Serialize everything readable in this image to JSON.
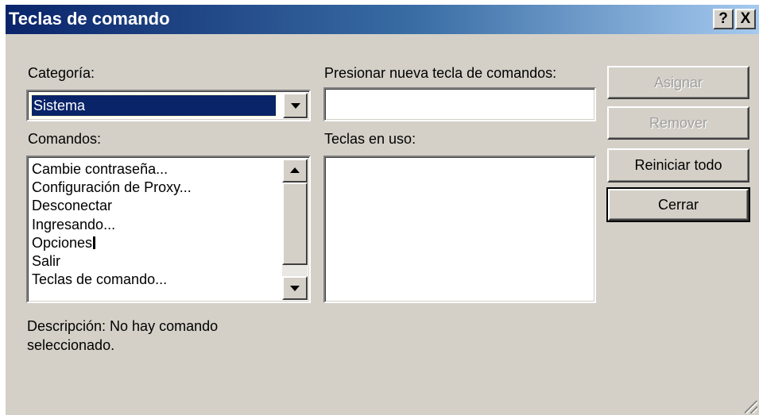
{
  "window": {
    "title": "Teclas de comando",
    "help_label": "?",
    "close_label": "X"
  },
  "category": {
    "label": "Categoría:",
    "selected": "Sistema"
  },
  "new_key": {
    "label": "Presionar nueva tecla de comandos:",
    "value": ""
  },
  "commands": {
    "label": "Comandos:",
    "items": [
      "Cambie contraseña...",
      "Configuración de Proxy...",
      "Desconectar",
      "Ingresando...",
      "Opciones",
      "Salir",
      "Teclas de comando..."
    ]
  },
  "keys_in_use": {
    "label": "Teclas en uso:"
  },
  "buttons": {
    "assign": "Asignar",
    "remove": "Remover",
    "reset_all": "Reiniciar todo",
    "close": "Cerrar"
  },
  "description": {
    "line1": "Descripción: No hay comando",
    "line2": "seleccionado."
  }
}
